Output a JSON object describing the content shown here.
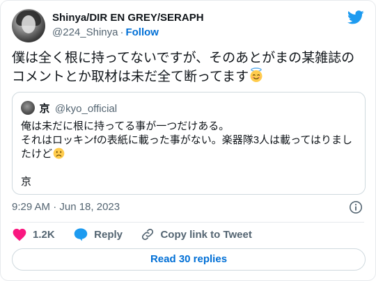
{
  "author": {
    "display_name": "Shinya/DIR EN GREY/SERAPH",
    "handle": "@224_Shinya",
    "separator": "·",
    "follow_label": "Follow"
  },
  "tweet": {
    "text": "僕は全く根に持ってないですが、そのあとがまの某雑誌のコメントとか取材は未だ全て断ってます",
    "emoji": "smiling-face-with-halo"
  },
  "quoted": {
    "name": "京",
    "handle": "@kyo_official",
    "lines": [
      "俺は未だに根に持ってる事が一つだけある。",
      "それはロッキンfの表紙に載った事がない。楽器隊3人は載ってはりまし",
      "たけど",
      "",
      "京"
    ],
    "emoji": "slightly-frowning-face"
  },
  "meta": {
    "timestamp": "9:29 AM · Jun 18, 2023"
  },
  "actions": {
    "like_count": "1.2K",
    "reply_label": "Reply",
    "copy_link_label": "Copy link to Tweet"
  },
  "read_replies_label": "Read 30 replies",
  "colors": {
    "brand_blue": "#1d9bf0",
    "link_blue": "#006fd6",
    "heart_pink": "#f91880",
    "secondary_text": "#536471",
    "border": "#cfd9de"
  }
}
